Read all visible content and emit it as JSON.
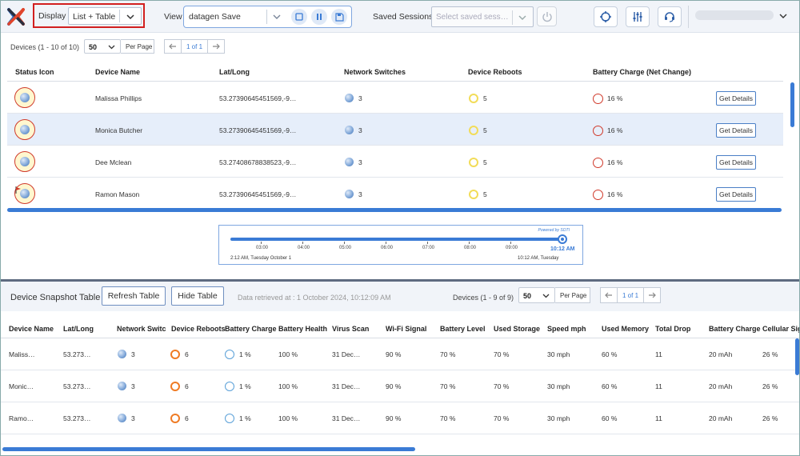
{
  "toolbar": {
    "display_label": "Display",
    "display_value": "List + Table",
    "view_label": "View",
    "view_value": "datagen Save",
    "saved_sessions_label": "Saved Sessions",
    "saved_sessions_placeholder": "Select saved sess…"
  },
  "top_pagination": {
    "devices_count": "Devices (1 - 10 of 10)",
    "page_size": "50",
    "per_page_label": "Per Page",
    "page_indicator": "1 of 1"
  },
  "top_table": {
    "headers": [
      "Status Icon",
      "Device Name",
      "Lat/Long",
      "Network Switches",
      "Device Reboots",
      "Battery Charge (Net Change)"
    ],
    "get_details_label": "Get Details",
    "rows": [
      {
        "name": "Malissa Phillips",
        "latlong": "53.27390645451569,-9…",
        "switches": "3",
        "reboots": "5",
        "battery": "16 %"
      },
      {
        "name": "Monica Butcher",
        "latlong": "53.27390645451569,-9…",
        "switches": "3",
        "reboots": "5",
        "battery": "16 %"
      },
      {
        "name": "Dee Mclean",
        "latlong": "53.27408678838523,-9…",
        "switches": "3",
        "reboots": "5",
        "battery": "16 %"
      },
      {
        "name": "Ramon Mason",
        "latlong": "53.27390645451569,-9…",
        "switches": "3",
        "reboots": "5",
        "battery": "16 %"
      }
    ]
  },
  "timeline": {
    "powered_by": "Powered by SOTI",
    "ticks": [
      "03:00",
      "04:00",
      "05:00",
      "06:00",
      "07:00",
      "08:00",
      "09:00"
    ],
    "start_label": "2:12 AM, Tuesday October 1",
    "end_label": "10:12 AM, Tuesday",
    "current_time": "10:12 AM",
    "progress_fraction": 1.0
  },
  "snapshot": {
    "title": "Device Snapshot Table",
    "refresh_label": "Refresh Table",
    "hide_label": "Hide Table",
    "retrieved": "Data retrieved at : 1 October 2024, 10:12:09 AM",
    "devices_count": "Devices (1 - 9 of 9)",
    "page_size": "50",
    "per_page_label": "Per Page",
    "page_indicator": "1 of 1",
    "headers": [
      "Device Name",
      "Lat/Long",
      "Network Switc",
      "Device Reboots",
      "Battery Charge",
      "Battery Health",
      "Virus Scan",
      "Wi-Fi Signal",
      "Battery Level",
      "Used Storage",
      "Speed mph",
      "Used Memory",
      "Total Drop",
      "Battery Charge",
      "Cellular Sig"
    ],
    "rows": [
      {
        "name": "Maliss…",
        "latlong": "53.273…",
        "switches": "3",
        "reboots": "6",
        "charge": "1 %",
        "health": "100 %",
        "virus": "31 Dec…",
        "wifi": "90 %",
        "level": "70 %",
        "storage": "70 %",
        "speed": "30 mph",
        "memory": "60 %",
        "drop": "11",
        "mah": "20 mAh",
        "cell": "26 %"
      },
      {
        "name": "Monic…",
        "latlong": "53.273…",
        "switches": "3",
        "reboots": "6",
        "charge": "1 %",
        "health": "100 %",
        "virus": "31 Dec…",
        "wifi": "90 %",
        "level": "70 %",
        "storage": "70 %",
        "speed": "30 mph",
        "memory": "60 %",
        "drop": "11",
        "mah": "20 mAh",
        "cell": "26 %"
      },
      {
        "name": "Ramo…",
        "latlong": "53.273…",
        "switches": "3",
        "reboots": "6",
        "charge": "1 %",
        "health": "100 %",
        "virus": "31 Dec…",
        "wifi": "90 %",
        "level": "70 %",
        "storage": "70 %",
        "speed": "30 mph",
        "memory": "60 %",
        "drop": "11",
        "mah": "20 mAh",
        "cell": "26 %"
      }
    ]
  },
  "colors": {
    "accent": "#3a7bd5",
    "highlight_box": "#d21f1f",
    "selected_row": "#e6eefa",
    "status_red": "#d03a2b",
    "reboot_yellow": "#f2dc58",
    "reboot_orange": "#ef7b24"
  },
  "icons": [
    "logo-icon",
    "chevron-down-icon",
    "stop-icon",
    "pause-icon",
    "save-icon",
    "power-icon",
    "crosshair-icon",
    "sliders-icon",
    "support-icon",
    "arrow-left-icon",
    "arrow-right-icon"
  ]
}
